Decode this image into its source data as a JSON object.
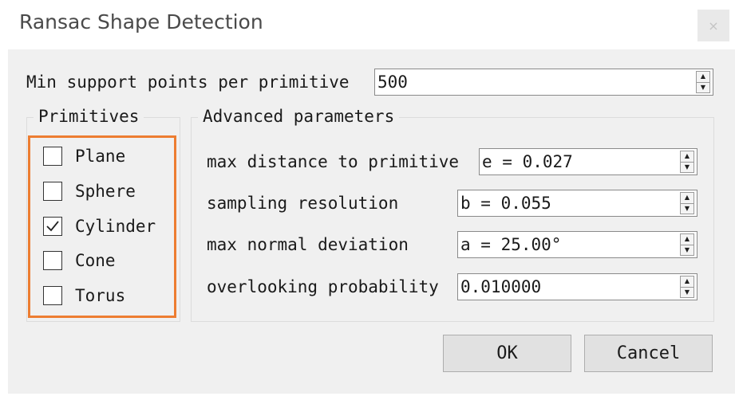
{
  "window": {
    "title": "Ransac Shape Detection",
    "close_glyph": "×"
  },
  "min_support": {
    "label": "Min support points per primitive",
    "value": "500"
  },
  "primitives": {
    "title": "Primitives",
    "items": [
      {
        "label": "Plane",
        "checked": false
      },
      {
        "label": "Sphere",
        "checked": false
      },
      {
        "label": "Cylinder",
        "checked": true
      },
      {
        "label": "Cone",
        "checked": false
      },
      {
        "label": "Torus",
        "checked": false
      }
    ]
  },
  "advanced": {
    "title": "Advanced parameters",
    "params": [
      {
        "label": "max distance to primitive",
        "value": "e = 0.027"
      },
      {
        "label": "sampling resolution",
        "value": "b = 0.055"
      },
      {
        "label": "max normal deviation",
        "value": "a = 25.00°"
      },
      {
        "label": "overlooking probability",
        "value": "0.010000"
      }
    ]
  },
  "buttons": {
    "ok": "OK",
    "cancel": "Cancel"
  },
  "colors": {
    "highlight": "#ed7d31",
    "dialog_bg": "#f0f0f0"
  },
  "icons": {
    "spin_up": "triangle-up-icon",
    "spin_down": "triangle-down-icon",
    "check": "checkmark-icon"
  }
}
